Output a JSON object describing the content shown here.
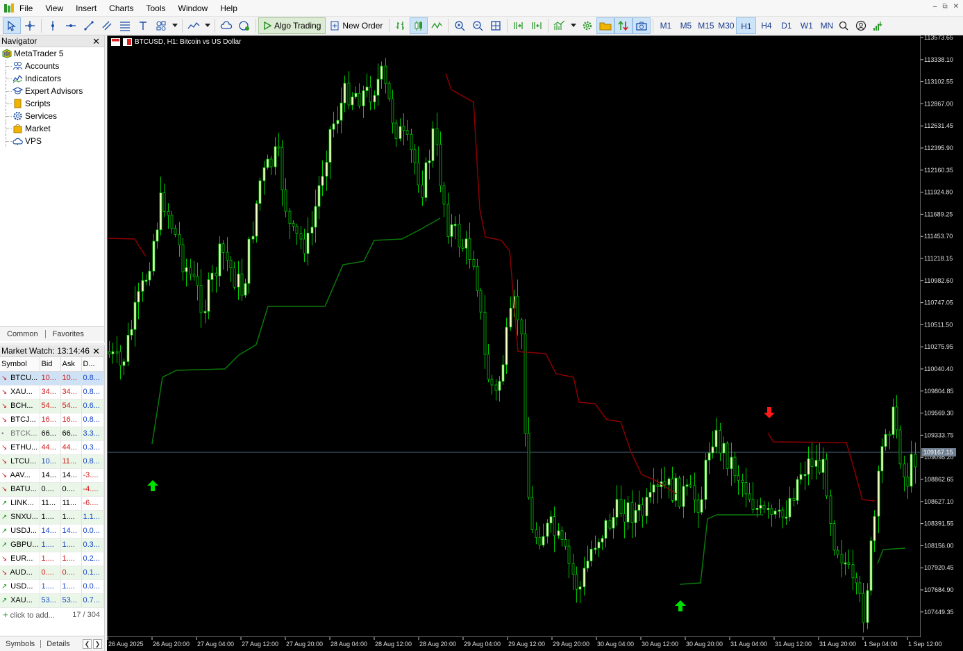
{
  "menu": [
    "File",
    "View",
    "Insert",
    "Charts",
    "Tools",
    "Window",
    "Help"
  ],
  "toolbar": {
    "algo_trading": "Algo Trading",
    "new_order": "New Order",
    "timeframes": [
      "M1",
      "M5",
      "M15",
      "M30",
      "H1",
      "H4",
      "D1",
      "W1",
      "MN"
    ],
    "active_timeframe": "H1"
  },
  "navigator": {
    "title": "Navigator",
    "root": "MetaTrader 5",
    "items": [
      "Accounts",
      "Indicators",
      "Expert Advisors",
      "Scripts",
      "Services",
      "Market",
      "VPS"
    ],
    "tabs": [
      "Common",
      "Favorites"
    ]
  },
  "market_watch": {
    "title": "Market Watch: 13:14:46",
    "columns": [
      "Symbol",
      "Bid",
      "Ask",
      "D..."
    ],
    "rows": [
      {
        "dir": "down",
        "symbol": "BTCU...",
        "bid": "10...",
        "ask": "10...",
        "d": "0.8...",
        "bidc": "red",
        "askc": "red",
        "dc": "blue"
      },
      {
        "dir": "down",
        "symbol": "XAU...",
        "bid": "34...",
        "ask": "34...",
        "d": "0.8...",
        "bidc": "red",
        "askc": "red",
        "dc": "blue"
      },
      {
        "dir": "down",
        "symbol": "BCH...",
        "bid": "54...",
        "ask": "54...",
        "d": "0.6...",
        "bidc": "red",
        "askc": "red",
        "dc": "blue"
      },
      {
        "dir": "down",
        "symbol": "BTCJ...",
        "bid": "16...",
        "ask": "16...",
        "d": "0.8...",
        "bidc": "red",
        "askc": "red",
        "dc": "blue"
      },
      {
        "dir": "dot",
        "symbol": "BTCK...",
        "bid": "66...",
        "ask": "66...",
        "d": "3.3...",
        "bidc": "",
        "askc": "",
        "dc": "blue"
      },
      {
        "dir": "down",
        "symbol": "ETHU...",
        "bid": "44...",
        "ask": "44...",
        "d": "0.3...",
        "bidc": "red",
        "askc": "red",
        "dc": "blue"
      },
      {
        "dir": "down",
        "symbol": "LTCU...",
        "bid": "10...",
        "ask": "11...",
        "d": "0.8...",
        "bidc": "blue",
        "askc": "red",
        "dc": "blue"
      },
      {
        "dir": "down",
        "symbol": "AAV...",
        "bid": "14...",
        "ask": "14...",
        "d": "-3....",
        "bidc": "",
        "askc": "",
        "dc": "red"
      },
      {
        "dir": "down",
        "symbol": "BATU...",
        "bid": "0....",
        "ask": "0....",
        "d": "-4....",
        "bidc": "",
        "askc": "",
        "dc": "red"
      },
      {
        "dir": "up",
        "symbol": "LINK...",
        "bid": "11...",
        "ask": "11...",
        "d": "-6....",
        "bidc": "",
        "askc": "",
        "dc": "red"
      },
      {
        "dir": "up",
        "symbol": "SNXU...",
        "bid": "1....",
        "ask": "1....",
        "d": "1.1...",
        "bidc": "",
        "askc": "",
        "dc": "blue"
      },
      {
        "dir": "up",
        "symbol": "USDJ...",
        "bid": "14...",
        "ask": "14...",
        "d": "0.0...",
        "bidc": "blue",
        "askc": "blue",
        "dc": "blue"
      },
      {
        "dir": "up",
        "symbol": "GBPU...",
        "bid": "1....",
        "ask": "1....",
        "d": "0.3...",
        "bidc": "blue",
        "askc": "blue",
        "dc": "blue"
      },
      {
        "dir": "down",
        "symbol": "EUR...",
        "bid": "1....",
        "ask": "1....",
        "d": "0.2...",
        "bidc": "red",
        "askc": "red",
        "dc": "blue"
      },
      {
        "dir": "down",
        "symbol": "AUD...",
        "bid": "0....",
        "ask": "0....",
        "d": "0.1...",
        "bidc": "red",
        "askc": "red",
        "dc": "blue"
      },
      {
        "dir": "up",
        "symbol": "USD...",
        "bid": "1....",
        "ask": "1....",
        "d": "0.0...",
        "bidc": "blue",
        "askc": "blue",
        "dc": "blue"
      },
      {
        "dir": "up",
        "symbol": "XAU...",
        "bid": "53...",
        "ask": "53...",
        "d": "0.7...",
        "bidc": "blue",
        "askc": "blue",
        "dc": "blue"
      }
    ],
    "add_label": "click to add...",
    "count": "17 / 304",
    "tabs": [
      "Symbols",
      "Details"
    ]
  },
  "chart": {
    "title": "BTCUSD, H1:  Bitcoin vs US Dollar",
    "current_price": "109167.15",
    "price_ticks": [
      "113573.65",
      "113338.10",
      "113102.55",
      "112867.00",
      "112631.45",
      "112395.90",
      "112160.35",
      "111924.80",
      "111689.25",
      "111453.70",
      "111218.15",
      "110982.60",
      "110747.05",
      "110511.50",
      "110275.95",
      "110040.40",
      "109804.85",
      "109569.30",
      "109333.75",
      "109098.20",
      "108862.65",
      "108627.10",
      "108391.55",
      "108156.00",
      "107920.45",
      "107684.90",
      "107449.35"
    ],
    "time_ticks": [
      "26 Aug 2025",
      "26 Aug 20:00",
      "27 Aug 04:00",
      "27 Aug 12:00",
      "27 Aug 20:00",
      "28 Aug 04:00",
      "28 Aug 12:00",
      "28 Aug 20:00",
      "29 Aug 04:00",
      "29 Aug 12:00",
      "29 Aug 20:00",
      "30 Aug 04:00",
      "30 Aug 12:00",
      "30 Aug 20:00",
      "31 Aug 04:00",
      "31 Aug 12:00",
      "31 Aug 20:00",
      "1 Sep 04:00",
      "1 Sep 12:00"
    ],
    "colors": {
      "bull": "#ffffcc",
      "bear": "#000000",
      "wick": "#00c800",
      "st_up": "#0a7a0a",
      "st_down": "#8b0000",
      "signal_up": "#00e000",
      "signal_down": "#ff1a1a"
    }
  }
}
